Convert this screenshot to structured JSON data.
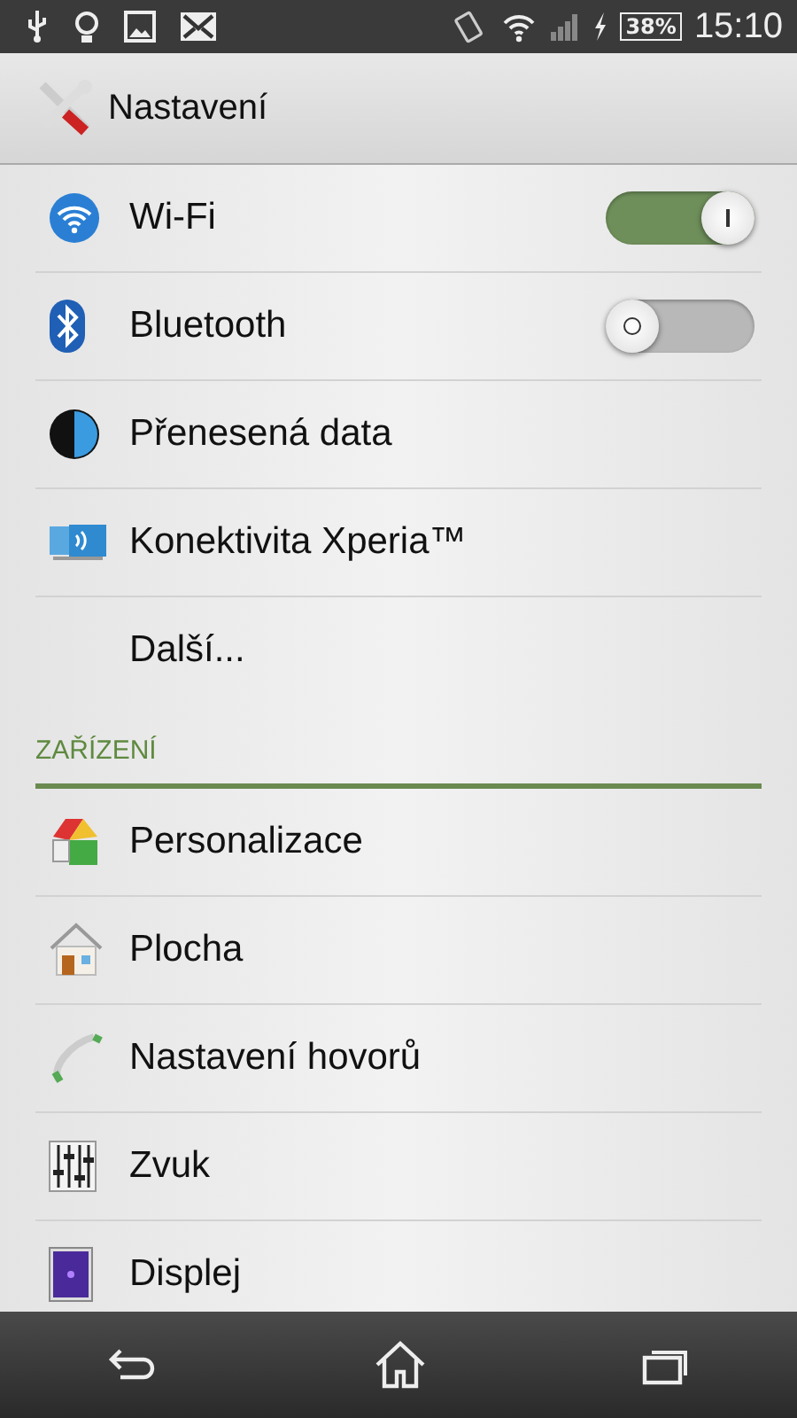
{
  "status_bar": {
    "battery": "38%",
    "time": "15:10"
  },
  "action_bar": {
    "title": "Nastavení"
  },
  "sections": [
    {
      "items": [
        {
          "label": "Wi-Fi",
          "kind": "toggle",
          "on": true
        },
        {
          "label": "Bluetooth",
          "kind": "toggle",
          "on": false
        },
        {
          "label": "Přenesená data",
          "kind": "plain"
        },
        {
          "label": "Konektivita Xperia™",
          "kind": "plain"
        },
        {
          "label": "Další...",
          "kind": "plain"
        }
      ]
    },
    {
      "header": "ZAŘÍZENÍ",
      "items": [
        {
          "label": "Personalizace",
          "kind": "plain"
        },
        {
          "label": "Plocha",
          "kind": "plain"
        },
        {
          "label": "Nastavení hovorů",
          "kind": "plain"
        },
        {
          "label": "Zvuk",
          "kind": "plain"
        },
        {
          "label": "Displej",
          "kind": "plain"
        }
      ]
    }
  ]
}
